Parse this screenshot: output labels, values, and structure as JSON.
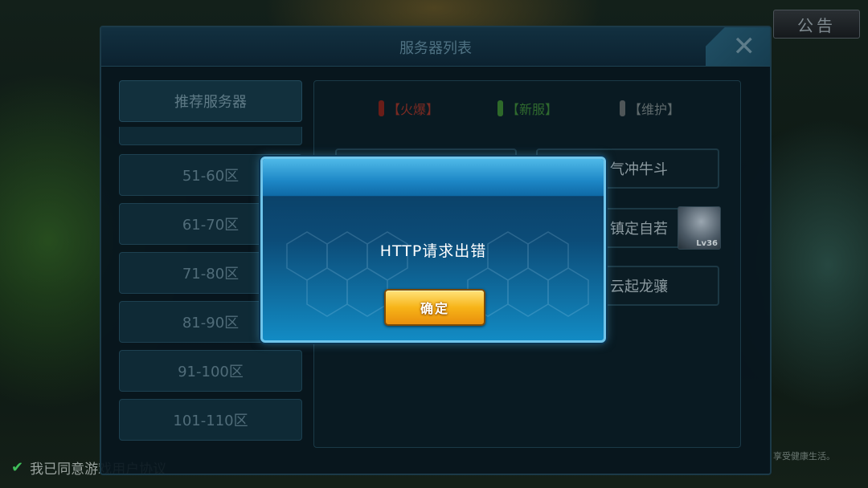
{
  "background": {
    "top_left_text": "",
    "notice_button": "公告",
    "agree_text": "我已同意游戏用户协议",
    "footer_right": "享受健康生活。"
  },
  "panel": {
    "title": "服务器列表",
    "close_icon": "close-icon",
    "tabs": [
      {
        "label": "推荐服务器"
      },
      {
        "label": "51-60区"
      },
      {
        "label": "61-70区"
      },
      {
        "label": "71-80区"
      },
      {
        "label": "81-90区"
      },
      {
        "label": "91-100区"
      },
      {
        "label": "101-110区"
      }
    ],
    "legend": {
      "hot": "【火爆】",
      "new": "【新服】",
      "maintenance": "【维护】"
    },
    "servers": [
      {
        "name": ""
      },
      {
        "name": "气冲牛斗"
      },
      {
        "name": "镇定自若"
      },
      {
        "name": "云起龙骧"
      }
    ],
    "avatar_level": "Lv36"
  },
  "dialog": {
    "message": "HTTP请求出错",
    "ok_label": "确定"
  },
  "colors": {
    "dialog_border": "#6fc4ea",
    "button_gold": "#f7b418",
    "hot": "#6a1d18",
    "new": "#2e6a2a",
    "maintenance": "#4f5658"
  }
}
